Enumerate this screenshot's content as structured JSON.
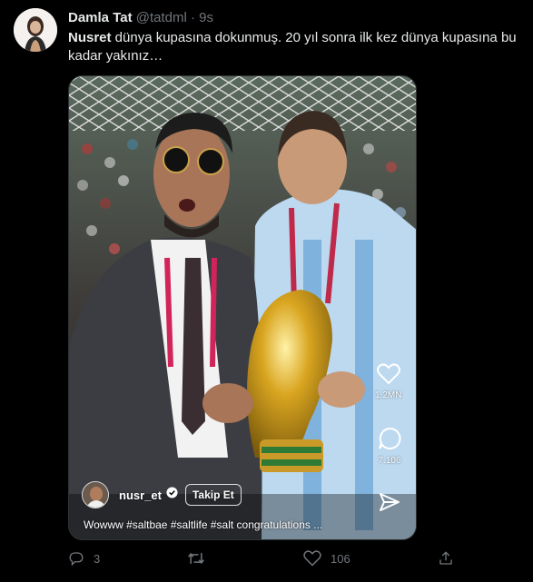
{
  "author": {
    "name": "Damla Tat",
    "handle": "@tatdml",
    "separator": "·",
    "time": "9s"
  },
  "tweet": {
    "text_bold": "Nusret",
    "text_rest": " dünya kupasına dokunmuş. 20 yıl sonra ilk kez dünya kupasına bu kadar yakınız…"
  },
  "media": {
    "reel_username": "nusr_et",
    "follow_label": "Takip Et",
    "caption": "Wowww #saltbae #saltlife #salt congratulations ...",
    "likes_count": "1,2MN",
    "comments_count": "7.106"
  },
  "actions": {
    "reply_count": "3",
    "retweet_count": "",
    "like_count": "106"
  },
  "colors": {
    "background": "#000000",
    "text_primary": "#e7e9ea",
    "text_secondary": "#71767b",
    "border": "#2f3336"
  },
  "icons": [
    "reply-icon",
    "retweet-icon",
    "like-icon",
    "share-icon",
    "heart-icon",
    "comment-icon",
    "send-icon",
    "verified-icon"
  ]
}
